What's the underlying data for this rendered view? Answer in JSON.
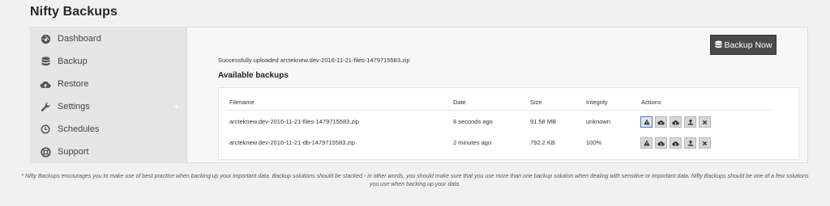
{
  "app": {
    "title": "Nifty Backups"
  },
  "sidebar": {
    "items": [
      {
        "label": "Dashboard",
        "icon": "dashboard-icon"
      },
      {
        "label": "Backup",
        "icon": "database-icon"
      },
      {
        "label": "Restore",
        "icon": "cloud-upload-icon"
      },
      {
        "label": "Settings",
        "icon": "wrench-icon",
        "expand": "+"
      },
      {
        "label": "Schedules",
        "icon": "clock-icon"
      },
      {
        "label": "Support",
        "icon": "lifebuoy-icon"
      }
    ]
  },
  "main": {
    "backup_now_label": "Backup Now",
    "status_message": "Successfully uploaded arcteknew.dev-2016-11-21-files-1479715583.zip",
    "section_title": "Available backups",
    "table": {
      "headers": [
        "Filename",
        "Date",
        "Size",
        "Integrity",
        "Actions"
      ],
      "rows": [
        {
          "filename": "arcteknew.dev-2016-11-21-files-1479715583.zip",
          "date": "8 seconds ago",
          "size": "91.58 MB",
          "integrity": "unknown"
        },
        {
          "filename": "arcteknew.dev-2016-11-21-db-1479715583.zip",
          "date": "2 minutes ago",
          "size": "792.2 KB",
          "integrity": "100%"
        }
      ],
      "actions": [
        "warning-icon",
        "cloud-download-icon",
        "cloud-upload-icon",
        "upload-icon",
        "delete-icon"
      ]
    }
  },
  "footnote": "* Nifty Backups encourages you to make use of best practice when backing up your important data. Backup solutions should be stacked - in other words, you should make sure that you use more than one backup solution when dealing with sensitive or important data. Nifty Backups should be one of a few solutions you use when backing up your data.",
  "colors": {
    "accent": "#4b7bbd",
    "button_dark": "#4a4a4a",
    "sidebar_bg": "#e6e6e6"
  }
}
